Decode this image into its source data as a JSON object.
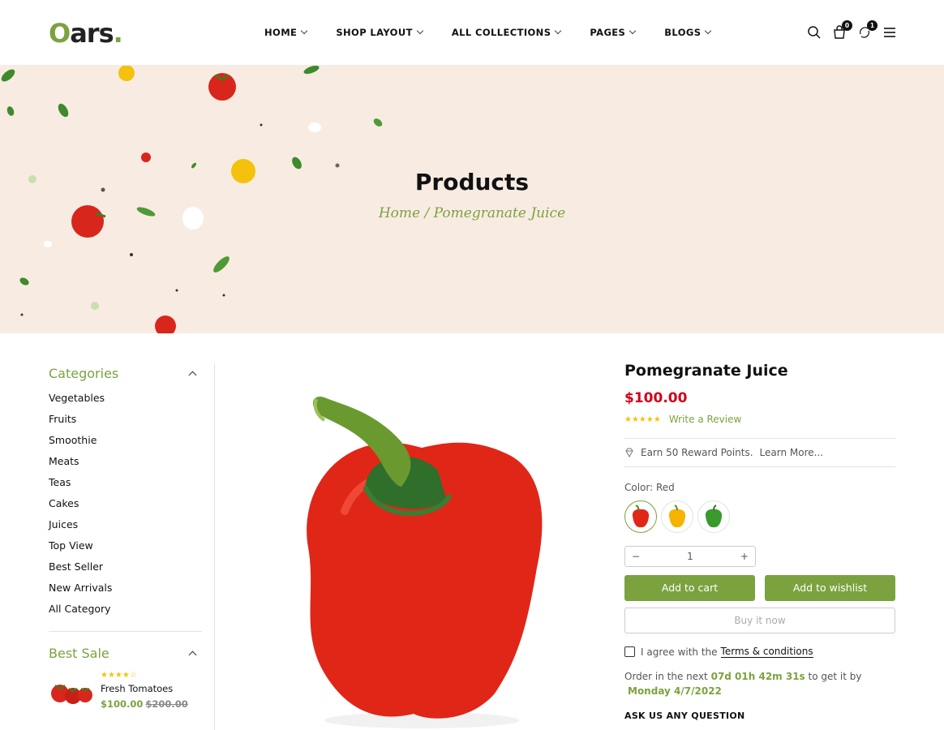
{
  "header": {
    "logo_letter": "O",
    "logo_text": "ars",
    "logo_dot": ".",
    "nav": [
      "HOME",
      "SHOP LAYOUT",
      "ALL COLLECTIONS",
      "PAGES",
      "BLOGS"
    ],
    "cart_count": "0",
    "compare_count": "1"
  },
  "banner": {
    "title": "Products",
    "breadcrumb_home": "Home",
    "breadcrumb_sep": " / ",
    "breadcrumb_current": "Pomegranate Juice"
  },
  "sidebar": {
    "categories_title": "Categories",
    "categories": [
      "Vegetables",
      "Fruits",
      "Smoothie",
      "Meats",
      "Teas",
      "Cakes",
      "Juices",
      "Top View",
      "Best Seller",
      "New Arrivals",
      "All Category"
    ],
    "best_sale_title": "Best Sale",
    "best_sale_item": {
      "name": "Fresh Tomatoes",
      "price": "$100.00",
      "old_price": "$200.00",
      "rating": 4
    }
  },
  "product": {
    "title": "Pomegranate Juice",
    "price": "$100.00",
    "rating": 5,
    "write_review": "Write a Review",
    "reward_text": "Earn 50 Reward Points.",
    "learn_more": "Learn More...",
    "color_label": "Color: Red",
    "colors": [
      "red",
      "yellow",
      "green"
    ],
    "quantity": "1",
    "qty_minus": "−",
    "qty_plus": "+",
    "add_to_cart": "Add to cart",
    "add_to_wishlist": "Add to wishlist",
    "buy_now": "Buy it now",
    "agree_text": "I agree with the",
    "terms_link": "Terms & conditions",
    "order_prefix": "Order in the next",
    "countdown": "07d 01h 42m 31s",
    "order_suffix": "to get it by",
    "delivery_date": "Monday 4/7/2022",
    "ask_question": "ASK US ANY QUESTION"
  },
  "colors": {
    "accent": "#7ba23f",
    "price_red": "#d0021b",
    "banner_bg": "#f8ece2"
  }
}
